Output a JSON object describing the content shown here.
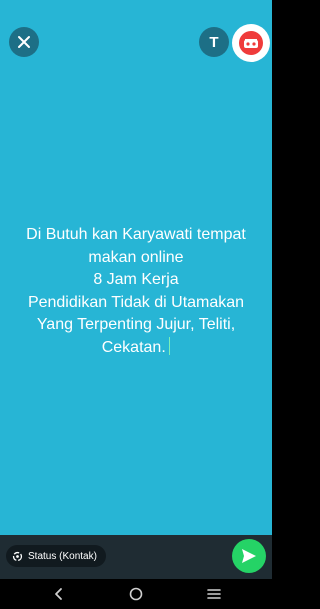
{
  "composer": {
    "status_text": "Di Butuh kan Karyawati tempat\nmakan online\n8 Jam Kerja\nPendidikan Tidak di Utamakan\nYang Terpenting Jujur, Teliti,\nCekatan.",
    "background_color": "#27b5d5",
    "text_color": "#ffffff"
  },
  "toolbar": {
    "close_icon": "close-icon",
    "text_style_label": "T",
    "sticker_icon": "emoji-sticker-icon"
  },
  "footer": {
    "audience_icon": "status-privacy-icon",
    "audience_label": "Status (Kontak)",
    "send_icon": "send-icon",
    "send_color": "#25d366"
  },
  "system_nav": {
    "back_icon": "back-icon",
    "home_icon": "home-icon",
    "recents_icon": "recents-icon"
  }
}
